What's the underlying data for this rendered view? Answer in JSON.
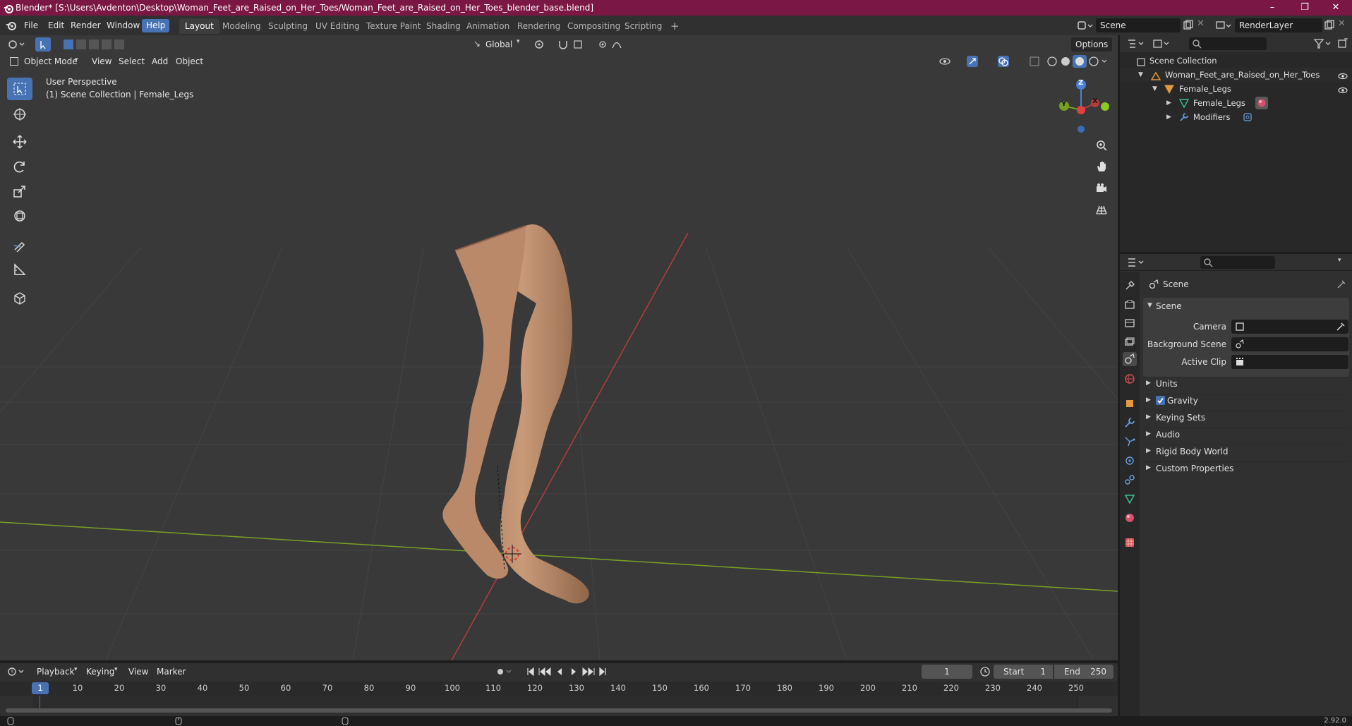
{
  "window": {
    "title": "Blender* [S:\\Users\\Avdenton\\Desktop\\Woman_Feet_are_Raised_on_Her_Toes/Woman_Feet_are_Raised_on_Her_Toes_blender_base.blend]",
    "minimize": "–",
    "maximize": "❐",
    "close": "✕"
  },
  "menu": {
    "items": [
      "File",
      "Edit",
      "Render",
      "Window",
      "Help"
    ],
    "active": "Help"
  },
  "workspaces": [
    "Layout",
    "Modeling",
    "Sculpting",
    "UV Editing",
    "Texture Paint",
    "Shading",
    "Animation",
    "Rendering",
    "Compositing",
    "Scripting"
  ],
  "workspace_active": "Layout",
  "workspace_add": "+",
  "scene_field": "Scene",
  "renderlayer_field": "RenderLayer",
  "viewport": {
    "mode": "Object Mode",
    "menus": [
      "View",
      "Select",
      "Add",
      "Object"
    ],
    "transform_orientation": "Global",
    "options": "Options",
    "overlay_title": "User Perspective",
    "overlay_subtitle": "(1) Scene Collection | Female_Legs",
    "gizmo": {
      "z": "Z",
      "y": "Y",
      "x": "X"
    }
  },
  "outliner": {
    "rows": [
      {
        "label": "Scene Collection"
      },
      {
        "label": "Woman_Feet_are_Raised_on_Her_Toes"
      },
      {
        "label": "Female_Legs"
      },
      {
        "label": "Female_Legs"
      },
      {
        "label": "Modifiers"
      }
    ]
  },
  "properties": {
    "context": "Scene",
    "panel": "Scene",
    "fields": [
      {
        "label": "Camera"
      },
      {
        "label": "Background Scene"
      },
      {
        "label": "Active Clip"
      }
    ],
    "subpanels": [
      "Units",
      "Gravity",
      "Keying Sets",
      "Audio",
      "Rigid Body World",
      "Custom Properties"
    ],
    "gravity_checked": true
  },
  "timeline": {
    "menus": [
      "Playback",
      "Keying",
      "View",
      "Marker"
    ],
    "current_frame": "1",
    "start_label": "Start",
    "start": "1",
    "end_label": "End",
    "end": "250",
    "ticks": [
      "1",
      "10",
      "20",
      "30",
      "40",
      "50",
      "60",
      "70",
      "80",
      "90",
      "100",
      "110",
      "120",
      "130",
      "140",
      "150",
      "160",
      "170",
      "180",
      "190",
      "200",
      "210",
      "220",
      "230",
      "240",
      "250"
    ]
  },
  "status": {
    "version": "2.92.0"
  },
  "colors": {
    "accent": "#4772b3",
    "titlebar": "#7b1745",
    "x_axis": "#b33d3d",
    "y_axis": "#78a024",
    "z_axis": "#4a80d6"
  }
}
